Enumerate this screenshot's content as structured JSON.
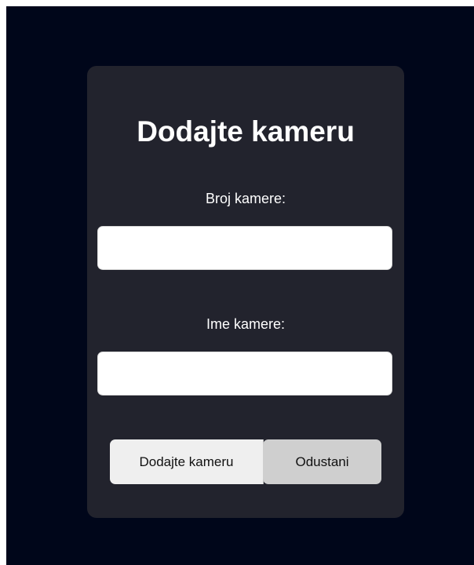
{
  "form": {
    "title": "Dodajte kameru",
    "camera_number_label": "Broj kamere:",
    "camera_number_value": "",
    "camera_name_label": "Ime kamere:",
    "camera_name_value": "",
    "submit_label": "Dodajte kameru",
    "cancel_label": "Odustani"
  },
  "colors": {
    "page_background": "#00061a",
    "card_background": "#22232d",
    "submit_button": "#efefef",
    "cancel_button": "#cfcfcf"
  }
}
